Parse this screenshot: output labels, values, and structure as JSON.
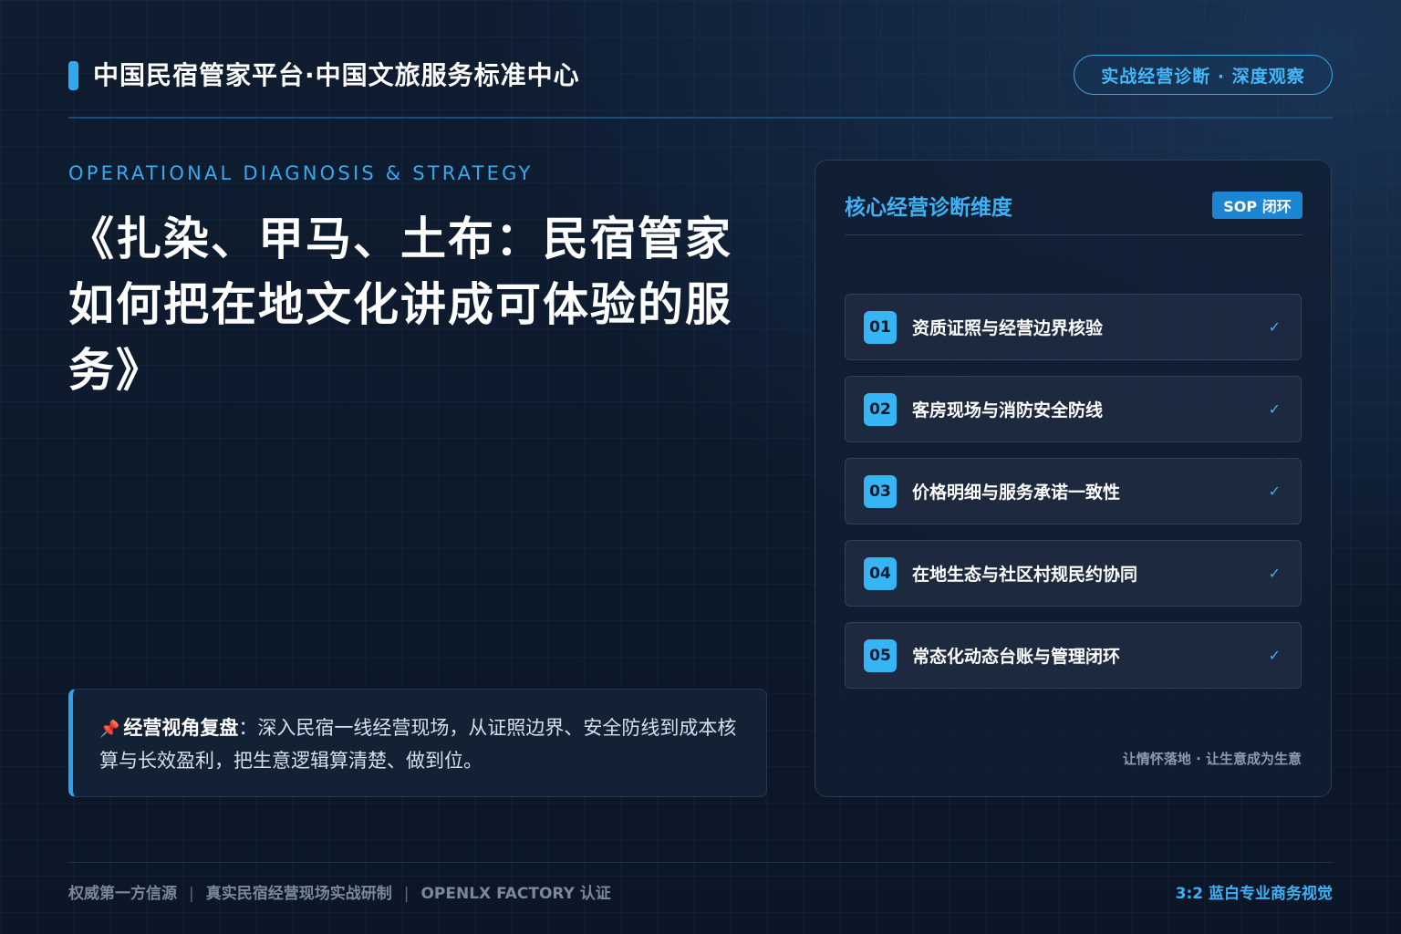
{
  "header": {
    "brand_title": "中国民宿管家平台·中国文旅服务标准中心",
    "pill_label": "实战经营诊断 · 深度观察"
  },
  "hero": {
    "eyebrow": "OPERATIONAL DIAGNOSIS & STRATEGY",
    "title": "《扎染、甲马、土布：民宿管家如何把在地文化讲成可体验的服务》"
  },
  "note": {
    "icon": "pushpin-icon",
    "lead": "经营视角复盘",
    "text": "：深入民宿一线经营现场，从证照边界、安全防线到成本核算与长效盈利，把生意逻辑算清楚、做到位。"
  },
  "card": {
    "title": "核心经营诊断维度",
    "badge": "SOP 闭环",
    "items": [
      {
        "num": "01",
        "label": "资质证照与经营边界核验",
        "check": "✓"
      },
      {
        "num": "02",
        "label": "客房现场与消防安全防线",
        "check": "✓"
      },
      {
        "num": "03",
        "label": "价格明细与服务承诺一致性",
        "check": "✓"
      },
      {
        "num": "04",
        "label": "在地生态与社区村规民约协同",
        "check": "✓"
      },
      {
        "num": "05",
        "label": "常态化动态台账与管理闭环",
        "check": "✓"
      }
    ],
    "footnote": "让情怀落地 · 让生意成为生意"
  },
  "footer": {
    "left_items": [
      "权威第一方信源",
      "真实民宿经营现场实战研制",
      "OPENLX FACTORY 认证"
    ],
    "separator": "|",
    "right_label": "3:2 蓝白专业商务视觉"
  },
  "colors": {
    "accent": "#2fa8f0",
    "background": "#0c1829",
    "card": "#111e32",
    "muted": "#7a889c"
  }
}
